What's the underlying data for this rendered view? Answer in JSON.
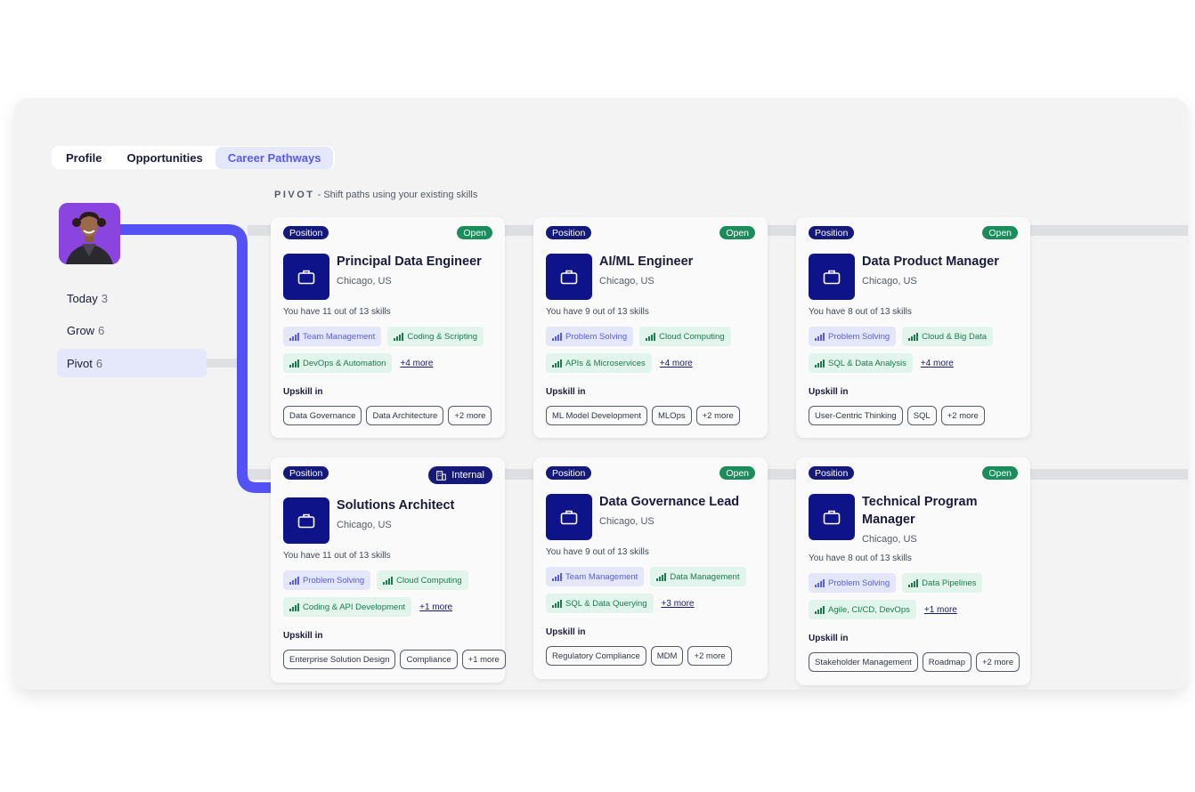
{
  "tabs": [
    {
      "label": "Profile",
      "active": false
    },
    {
      "label": "Opportunities",
      "active": false
    },
    {
      "label": "Career Pathways",
      "active": true
    }
  ],
  "pivot_heading": {
    "word": "PIVOT",
    "separator": "-",
    "text": "Shift paths using your existing skills"
  },
  "sidebar": [
    {
      "label": "Today",
      "count": "3",
      "active": false
    },
    {
      "label": "Grow",
      "count": "6",
      "active": false
    },
    {
      "label": "Pivot",
      "count": "6",
      "active": true
    }
  ],
  "colors": {
    "accent": "#5a5de0",
    "navy": "#151a7a",
    "open_green": "#1d8c5d",
    "path_line": "#5452f5"
  },
  "cards": [
    {
      "type_label": "Position",
      "status": "Open",
      "status_kind": "open",
      "title": "Principal Data Engineer",
      "location": "Chicago, US",
      "skills_summary": "You have 11 out of 13 skills",
      "skills": [
        {
          "label": "Team Management",
          "tone": "purple"
        },
        {
          "label": "Coding & Scripting",
          "tone": "green"
        },
        {
          "label": "DevOps & Automation",
          "tone": "green"
        }
      ],
      "more_skills": "+4 more",
      "upskill_label": "Upskill in",
      "upskill": [
        "Data Governance",
        "Data Architecture",
        "+2 more"
      ]
    },
    {
      "type_label": "Position",
      "status": "Open",
      "status_kind": "open",
      "title": "AI/ML Engineer",
      "location": "Chicago, US",
      "skills_summary": "You have 9 out of 13 skills",
      "skills": [
        {
          "label": "Problem Solving",
          "tone": "purple"
        },
        {
          "label": "Cloud Computing",
          "tone": "green"
        },
        {
          "label": "APIs & Microservices",
          "tone": "green"
        }
      ],
      "more_skills": "+4 more",
      "upskill_label": "Upskill in",
      "upskill": [
        "ML Model Development",
        "MLOps",
        "+2 more"
      ]
    },
    {
      "type_label": "Position",
      "status": "Open",
      "status_kind": "open",
      "title": "Data Product Manager",
      "location": "Chicago, US",
      "skills_summary": "You have 8 out of 13 skills",
      "skills": [
        {
          "label": "Problem Solving",
          "tone": "purple"
        },
        {
          "label": "Cloud & Big Data",
          "tone": "green"
        },
        {
          "label": "SQL & Data Analysis",
          "tone": "green"
        }
      ],
      "more_skills": "+4 more",
      "upskill_label": "Upskill in",
      "upskill": [
        "User-Centric Thinking",
        "SQL",
        "+2 more"
      ]
    },
    {
      "type_label": "Position",
      "status": "Internal",
      "status_kind": "internal",
      "title": "Solutions Architect",
      "location": "Chicago, US",
      "skills_summary": "You have 11 out of 13 skills",
      "skills": [
        {
          "label": "Problem Solving",
          "tone": "purple"
        },
        {
          "label": "Cloud Computing",
          "tone": "green"
        },
        {
          "label": "Coding & API Development",
          "tone": "green"
        }
      ],
      "more_skills": "+1 more",
      "upskill_label": "Upskill in",
      "upskill": [
        "Enterprise Solution Design",
        "Compliance",
        "+1 more"
      ]
    },
    {
      "type_label": "Position",
      "status": "Open",
      "status_kind": "open",
      "title": "Data Governance Lead",
      "location": "Chicago, US",
      "skills_summary": "You have 9 out of 13 skills",
      "skills": [
        {
          "label": "Team Management",
          "tone": "purple"
        },
        {
          "label": "Data Management",
          "tone": "green"
        },
        {
          "label": "SQL & Data Querying",
          "tone": "green"
        }
      ],
      "more_skills": "+3 more",
      "upskill_label": "Upskill in",
      "upskill": [
        "Regulatory Compliance",
        "MDM",
        "+2 more"
      ]
    },
    {
      "type_label": "Position",
      "status": "Open",
      "status_kind": "open",
      "title": "Technical Program Manager",
      "location": "Chicago, US",
      "skills_summary": "You have 8 out of 13 skills",
      "skills": [
        {
          "label": "Problem Solving",
          "tone": "purple"
        },
        {
          "label": "Data Pipelines",
          "tone": "green"
        },
        {
          "label": "Agile, CI/CD, DevOps",
          "tone": "green"
        }
      ],
      "more_skills": "+1 more",
      "upskill_label": "Upskill in",
      "upskill": [
        "Stakeholder Management",
        "Roadmap",
        "+2 more"
      ]
    }
  ]
}
